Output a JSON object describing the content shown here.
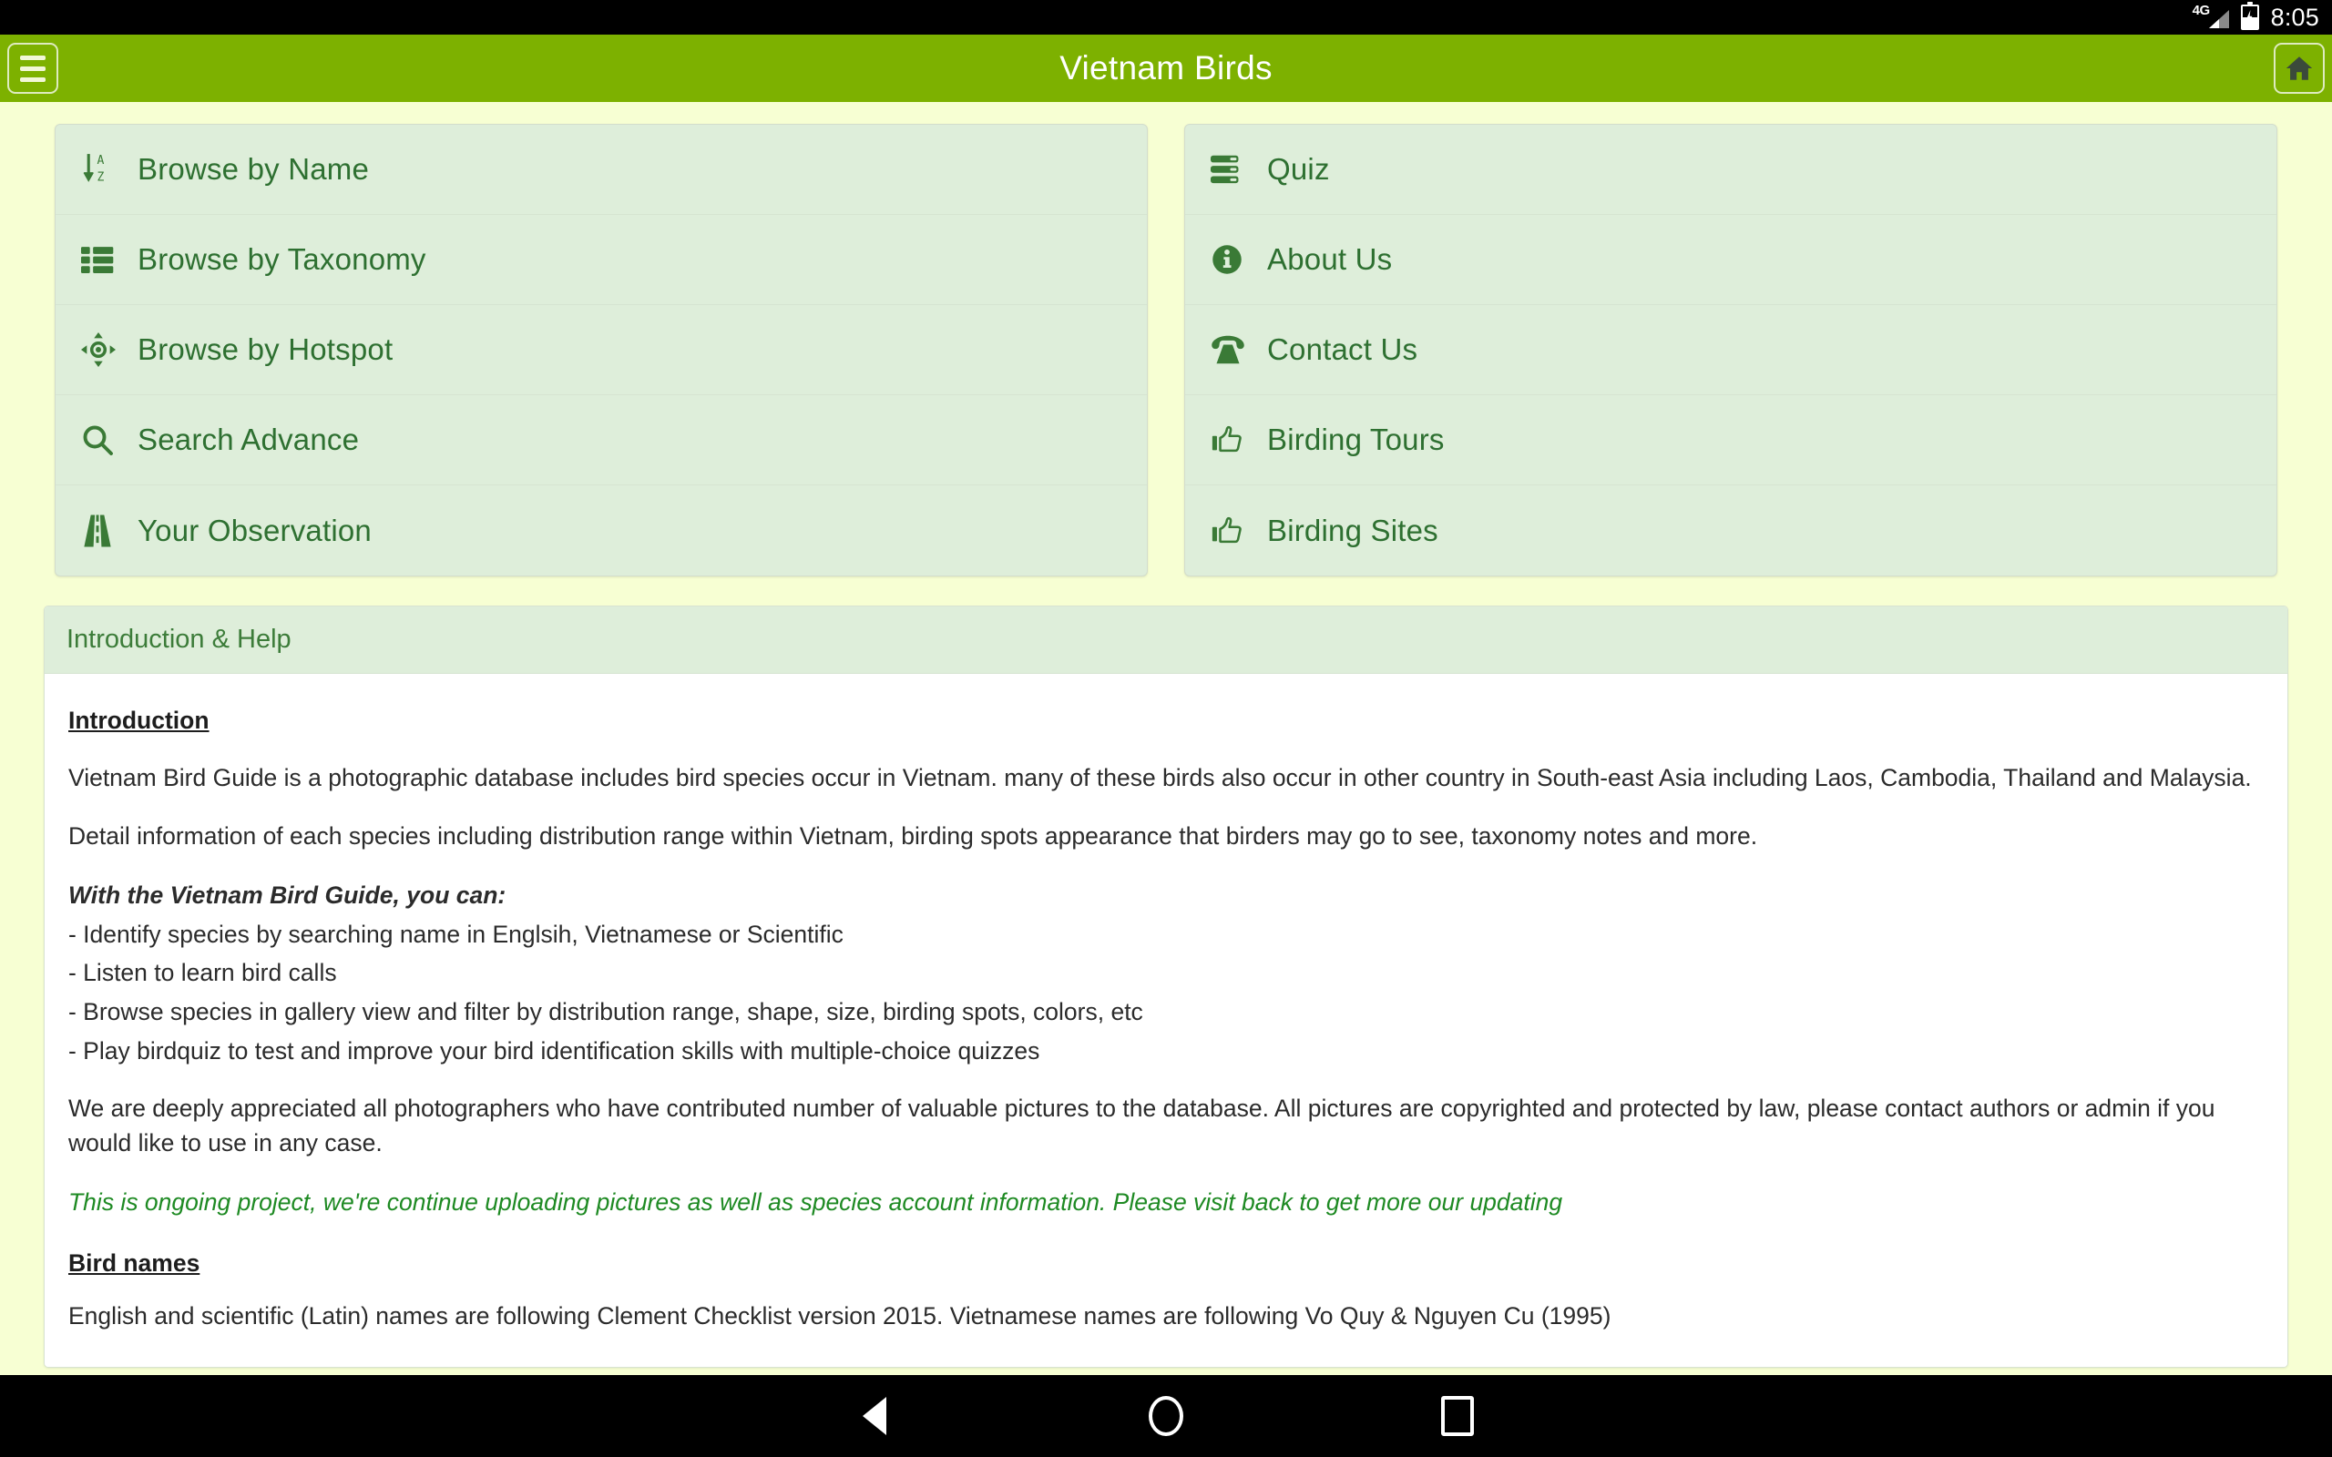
{
  "statusbar": {
    "network_label": "4G",
    "signal_icon": "signal-bars-icon",
    "battery_icon": "battery-charging-icon",
    "clock": "8:05"
  },
  "appbar": {
    "menu_icon": "hamburger-menu-icon",
    "title": "Vietnam Birds",
    "home_icon": "home-icon"
  },
  "menu_left": [
    {
      "icon": "sort-alpha-down-icon",
      "label": "Browse by Name"
    },
    {
      "icon": "list-ul-icon",
      "label": "Browse by Taxonomy"
    },
    {
      "icon": "crosshairs-icon",
      "label": "Browse by Hotspot"
    },
    {
      "icon": "search-icon",
      "label": "Search Advance"
    },
    {
      "icon": "road-icon",
      "label": "Your Observation"
    }
  ],
  "menu_right": [
    {
      "icon": "server-icon",
      "label": "Quiz"
    },
    {
      "icon": "info-circle-icon",
      "label": "About Us"
    },
    {
      "icon": "phone-icon",
      "label": "Contact Us"
    },
    {
      "icon": "thumbs-up-icon",
      "label": "Birding Tours"
    },
    {
      "icon": "thumbs-up-icon",
      "label": "Birding Sites"
    }
  ],
  "panel": {
    "header": "Introduction & Help",
    "intro_heading": "Introduction",
    "para1": "Vietnam Bird Guide is a photographic database includes bird species occur in Vietnam. many of these birds also occur in other country in South-east Asia including Laos, Cambodia, Thailand and Malaysia.",
    "para2": "Detail information of each species including distribution range within Vietnam, birding spots appearance that birders may go to see, taxonomy notes and more.",
    "can_heading": "With the Vietnam Bird Guide, you can:",
    "bullets": [
      "- Identify species by searching name in Englsih, Vietnamese or Scientific",
      "- Listen to learn bird calls",
      "- Browse species in gallery view and filter by distribution range, shape, size, birding spots, colors, etc",
      "- Play birdquiz to test and improve your bird identification skills with multiple-choice quizzes"
    ],
    "para3": "We are deeply appreciated all photographers who have contributed number of valuable pictures to the database. All pictures are copyrighted and protected by law, please contact authors or admin if you would like to use in any case.",
    "ongoing_note": "This is ongoing project, we're continue uploading pictures as well as species account information. Please visit back to get more our updating",
    "birdnames_heading": "Bird names",
    "birdnames_para": "English and scientific (Latin) names are following Clement Checklist version 2015. Vietnamese names are following Vo Quy & Nguyen Cu (1995)"
  },
  "navbar": {
    "back_icon": "nav-back-icon",
    "home_icon": "nav-home-icon",
    "recent_icon": "nav-recent-icon"
  },
  "colors": {
    "brand_green": "#7DB100",
    "page_bg": "#F7FFD3",
    "card_bg": "#DEEEDA",
    "label_green": "#2E7031",
    "accent_green": "#1E8A23"
  }
}
